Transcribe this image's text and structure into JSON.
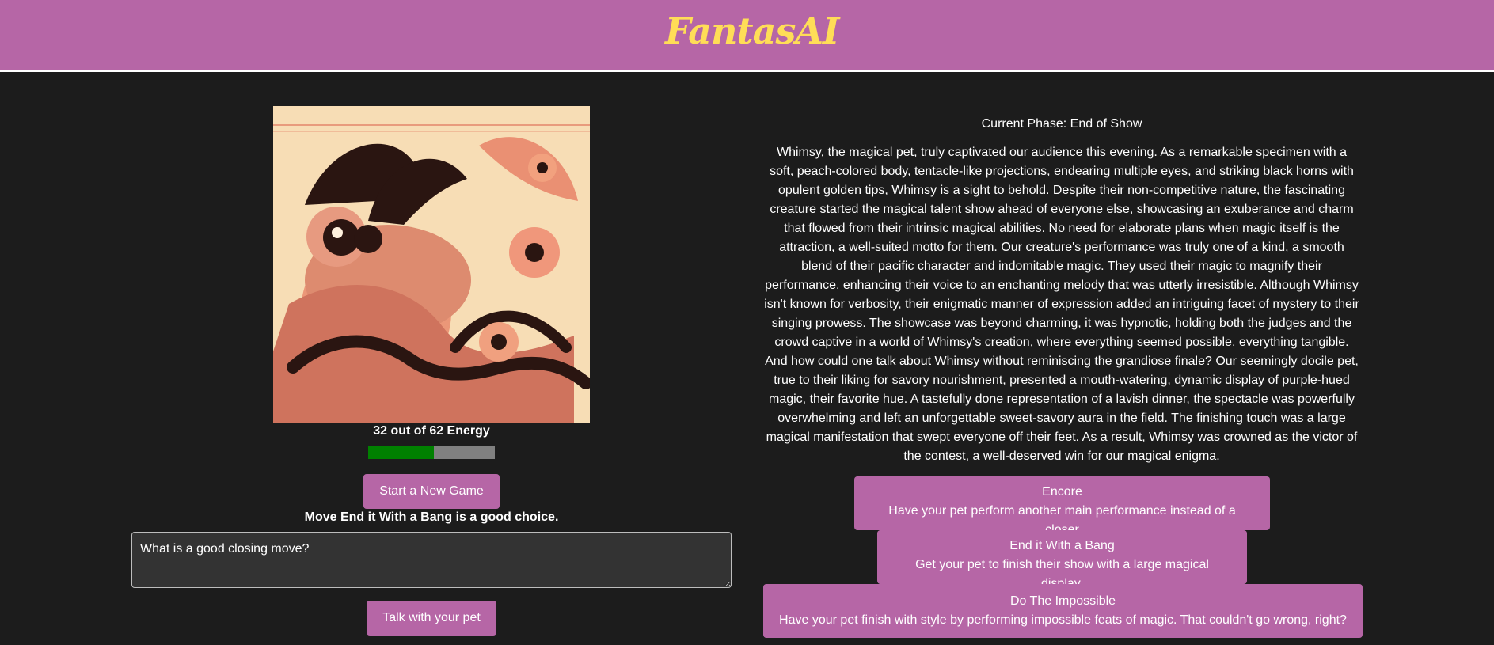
{
  "app": {
    "logo_text": "FantasAI",
    "brand_color": "#b666a6",
    "logo_color": "#ffdd57"
  },
  "pet": {
    "image_icon": "fantasy-creature-illustration",
    "energy_text": "32 out of 62 Energy",
    "energy_current": 32,
    "energy_max": 62,
    "energy_fill_color": "#008000"
  },
  "controls": {
    "new_game_label": "Start a New Game",
    "advice_text": "Move End it With a Bang is a good choice.",
    "talk_input_value": "What is a good closing move?",
    "talk_button_label": "Talk with your pet"
  },
  "show": {
    "phase_text": "Current Phase: End of Show",
    "story": "Whimsy, the magical pet, truly captivated our audience this evening. As a remarkable specimen with a soft, peach-colored body, tentacle-like projections, endearing multiple eyes, and striking black horns with opulent golden tips, Whimsy is a sight to behold. Despite their non-competitive nature, the fascinating creature started the magical talent show ahead of everyone else, showcasing an exuberance and charm that flowed from their intrinsic magical abilities. No need for elaborate plans when magic itself is the attraction, a well-suited motto for them. Our creature's performance was truly one of a kind, a smooth blend of their pacific character and indomitable magic. They used their magic to magnify their performance, enhancing their voice to an enchanting melody that was utterly irresistible. Although Whimsy isn't known for verbosity, their enigmatic manner of expression added an intriguing facet of mystery to their singing prowess. The showcase was beyond charming, it was hypnotic, holding both the judges and the crowd captive in a world of Whimsy's creation, where everything seemed possible, everything tangible. And how could one talk about Whimsy without reminiscing the grandiose finale? Our seemingly docile pet, true to their liking for savory nourishment, presented a mouth-watering, dynamic display of purple-hued magic, their favorite hue. A tastefully done representation of a lavish dinner, the spectacle was powerfully overwhelming and left an unforgettable sweet-savory aura in the field. The finishing touch was a large magical manifestation that swept everyone off their feet. As a result, Whimsy was crowned as the victor of the contest, a well-deserved win for our magical enigma.",
    "moves": [
      {
        "title": "Encore",
        "description": "Have your pet perform another main performance instead of a closer"
      },
      {
        "title": "End it With a Bang",
        "description": "Get your pet to finish their show with a large magical display."
      },
      {
        "title": "Do The Impossible",
        "description": "Have your pet finish with style by performing impossible feats of magic. That couldn't go wrong, right?"
      }
    ]
  }
}
